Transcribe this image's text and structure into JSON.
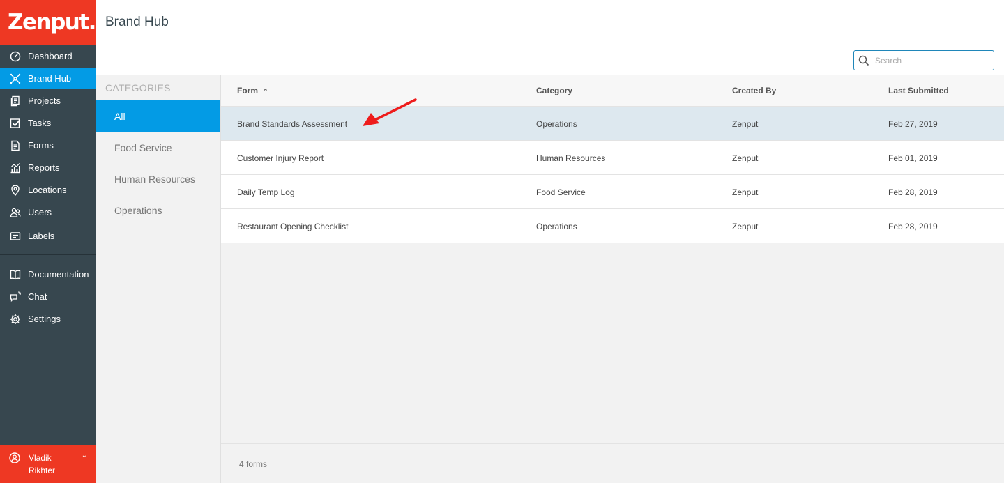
{
  "app": {
    "logo_text": "Zenput.",
    "brand_color": "#ee3823",
    "accent_color": "#039be5"
  },
  "sidebar": {
    "items": [
      {
        "label": "Dashboard",
        "icon": "dashboard-icon"
      },
      {
        "label": "Brand Hub",
        "icon": "brand-hub-icon",
        "active": true
      },
      {
        "label": "Projects",
        "icon": "projects-icon"
      },
      {
        "label": "Tasks",
        "icon": "tasks-icon"
      },
      {
        "label": "Forms",
        "icon": "forms-icon"
      },
      {
        "label": "Reports",
        "icon": "reports-icon"
      },
      {
        "label": "Locations",
        "icon": "location-pin-icon"
      },
      {
        "label": "Users",
        "icon": "users-icon"
      },
      {
        "label": "Labels",
        "icon": "labels-icon"
      }
    ],
    "secondary": [
      {
        "label": "Documentation",
        "icon": "book-icon"
      },
      {
        "label": "Chat",
        "icon": "chat-icon"
      },
      {
        "label": "Settings",
        "icon": "gear-icon"
      }
    ],
    "user": {
      "name": "Vladik Rikhter",
      "icon": "user-circle-icon"
    }
  },
  "header": {
    "title": "Brand Hub"
  },
  "search": {
    "placeholder": "Search",
    "value": ""
  },
  "categories": {
    "title": "CATEGORIES",
    "items": [
      {
        "label": "All",
        "active": true
      },
      {
        "label": "Food Service"
      },
      {
        "label": "Human Resources"
      },
      {
        "label": "Operations"
      }
    ]
  },
  "table": {
    "columns": [
      "Form",
      "Category",
      "Created By",
      "Last Submitted"
    ],
    "sort_column": "Form",
    "sort_direction": "ascending",
    "rows": [
      {
        "form": "Brand Standards Assessment",
        "category": "Operations",
        "created_by": "Zenput",
        "last_submitted": "Feb 27, 2019",
        "selected": true
      },
      {
        "form": "Customer Injury Report",
        "category": "Human Resources",
        "created_by": "Zenput",
        "last_submitted": "Feb 01, 2019"
      },
      {
        "form": "Daily Temp Log",
        "category": "Food Service",
        "created_by": "Zenput",
        "last_submitted": "Feb 28, 2019"
      },
      {
        "form": "Restaurant Opening Checklist",
        "category": "Operations",
        "created_by": "Zenput",
        "last_submitted": "Feb 28, 2019"
      }
    ]
  },
  "footer": {
    "count_text": "4 forms"
  },
  "annotation": {
    "type": "red-arrow-icon",
    "color": "#ee1c1c"
  }
}
